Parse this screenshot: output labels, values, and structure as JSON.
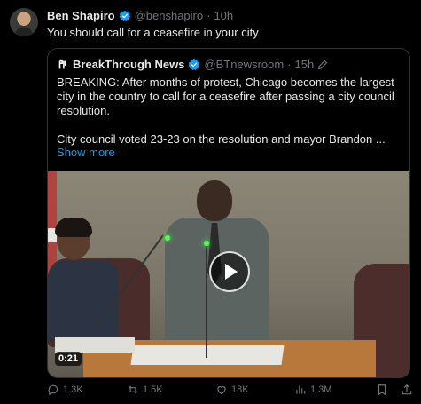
{
  "tweet": {
    "author_name": "Ben Shapiro",
    "handle": "@benshapiro",
    "separator": "·",
    "time": "10h",
    "text": "You should call for a ceasefire in your city"
  },
  "quote": {
    "author_name": "BreakThrough News",
    "handle": "@BTnewsroom",
    "separator": "·",
    "time": "15h",
    "text_line1": "BREAKING: After months of protest, Chicago becomes the largest city in the country to call for a ceasefire after passing a city council resolution.",
    "text_line2": "City council voted 23-23 on the resolution and mayor Brandon ...",
    "show_more": "Show more",
    "video": {
      "duration": "0:21",
      "play_icon": "play-icon"
    }
  },
  "actions": {
    "replies": "1.3K",
    "reposts": "1.5K",
    "likes": "18K",
    "views": "1.3M"
  },
  "colors": {
    "background": "#000000",
    "text": "#e7e9ea",
    "muted": "#71767b",
    "link": "#1d9bf0",
    "verified": "#1d9bf0"
  }
}
